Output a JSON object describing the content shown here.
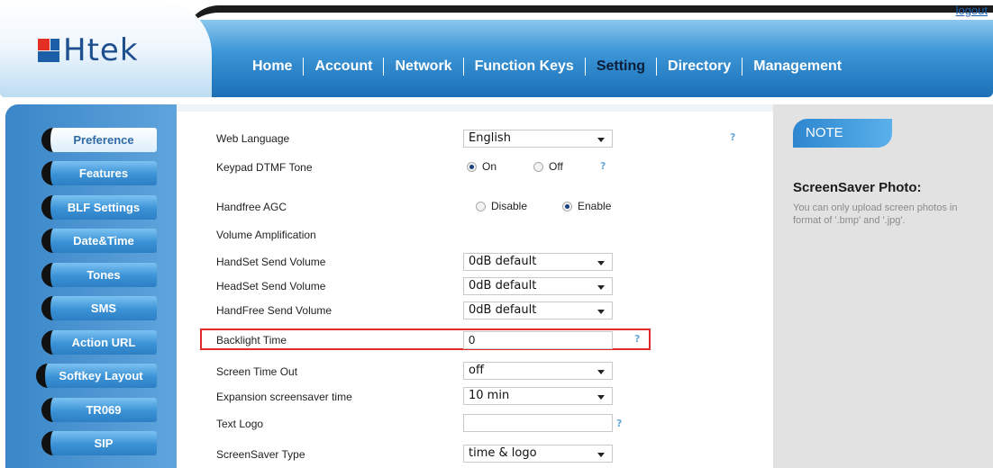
{
  "header": {
    "logo_text": "Htek",
    "logout": "logout",
    "nav": [
      "Home",
      "Account",
      "Network",
      "Function Keys",
      "Setting",
      "Directory",
      "Management"
    ],
    "active_nav": "Setting"
  },
  "sidebar": {
    "items": [
      "Preference",
      "Features",
      "BLF Settings",
      "Date&Time",
      "Tones",
      "SMS",
      "Action URL",
      "Softkey Layout",
      "TR069",
      "SIP"
    ],
    "active": "Preference"
  },
  "form": {
    "web_language": {
      "label": "Web Language",
      "value": "English"
    },
    "keypad_dtmf": {
      "label": "Keypad DTMF Tone",
      "options": [
        "On",
        "Off"
      ],
      "selected": "On"
    },
    "handfree_agc": {
      "label": "Handfree AGC",
      "options": [
        "Disable",
        "Enable"
      ],
      "selected": "Enable"
    },
    "volume_amplification": {
      "label": "Volume Amplification"
    },
    "handset_send": {
      "label": "HandSet Send Volume",
      "value": "0dB default"
    },
    "headset_send": {
      "label": "HeadSet Send Volume",
      "value": "0dB default"
    },
    "handfree_send": {
      "label": "HandFree Send Volume",
      "value": "0dB default"
    },
    "backlight_time": {
      "label": "Backlight Time",
      "value": "0"
    },
    "screen_timeout": {
      "label": "Screen Time Out",
      "value": "off"
    },
    "expansion_screensaver": {
      "label": "Expansion screensaver time",
      "value": "10 min"
    },
    "text_logo": {
      "label": "Text Logo",
      "value": ""
    },
    "screensaver_type": {
      "label": "ScreenSaver Type",
      "value": "time & logo"
    },
    "help_glyph": "?"
  },
  "note": {
    "tab": "NOTE",
    "title": "ScreenSaver Photo:",
    "text": "You can only upload screen photos in format of '.bmp' and '.jpg'."
  },
  "colors": {
    "header_blue": "#1b6fb6",
    "highlight_red": "#e02b2b",
    "active_nav": "#0b1f3a"
  }
}
